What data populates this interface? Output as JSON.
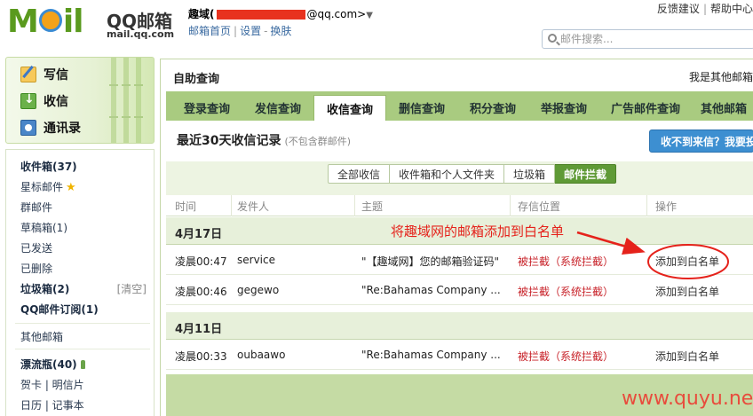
{
  "header": {
    "brand": "QQ邮箱",
    "domain": "mail.qq.com",
    "user_name": "趣域(",
    "user_email": "@qq.com>",
    "caret": "▼",
    "home_link": "邮箱首页",
    "settings_link": "设置",
    "switch_link": "换肤",
    "feedback": "反馈建议",
    "help_center": "帮助中心",
    "search_placeholder": "邮件搜索..."
  },
  "sidebar": {
    "compose": "写信",
    "receive": "收信",
    "contacts": "通讯录",
    "items": [
      {
        "label": "收件箱(37)",
        "bold": true
      },
      {
        "label": "星标邮件",
        "bold": false
      },
      {
        "label": "群邮件",
        "bold": false
      },
      {
        "label": "草稿箱(1)",
        "bold": false
      },
      {
        "label": "已发送",
        "bold": false
      },
      {
        "label": "已删除",
        "bold": false
      },
      {
        "label": "垃圾箱(2)",
        "bold": true,
        "extra": "[清空]"
      },
      {
        "label": "QQ邮件订阅(1)",
        "bold": true
      },
      {
        "label": "其他邮箱",
        "bold": false
      },
      {
        "label": "漂流瓶(40)",
        "bold": true
      },
      {
        "label": "贺卡 | 明信片",
        "bold": false
      },
      {
        "label": "日历 | 记事本",
        "bold": false
      }
    ]
  },
  "main": {
    "title": "自助查询",
    "right_text": "我是其他邮箱",
    "tabs": [
      "登录查询",
      "发信查询",
      "收信查询",
      "删信查询",
      "积分查询",
      "举报查询",
      "广告邮件查询",
      "其他邮箱"
    ],
    "active_tab": "收信查询",
    "section_title": "最近30天收信记录",
    "section_note": "(不包含群邮件)",
    "help_button": "收不到来信？我要投",
    "filters": [
      "全部收信",
      "收件箱和个人文件夹",
      "垃圾箱",
      "邮件拦截"
    ],
    "active_filter": "邮件拦截",
    "columns": [
      "时间",
      "发件人",
      "主题",
      "存信位置",
      "操作"
    ],
    "groups": [
      {
        "date": "4月17日",
        "rows": [
          {
            "time": "凌晨00:47",
            "sender": "service",
            "subject": "\"【趣域网】您的邮箱验证码\"",
            "location": "被拦截（系统拦截）",
            "action": "添加到白名单"
          },
          {
            "time": "凌晨00:46",
            "sender": "gegewo",
            "subject": "\"Re:Bahamas Company ...",
            "location": "被拦截（系统拦截）",
            "action": "添加到白名单"
          }
        ]
      },
      {
        "date": "4月11日",
        "rows": [
          {
            "time": "凌晨00:33",
            "sender": "oubaawo",
            "subject": "\"Re:Bahamas Company ...",
            "location": "被拦截（系统拦截）",
            "action": "添加到白名单"
          }
        ]
      }
    ]
  },
  "annotation": {
    "text": "将趣域网的邮箱添加到白名单",
    "color": "#e5221b"
  },
  "watermark": "www.quyu.net"
}
